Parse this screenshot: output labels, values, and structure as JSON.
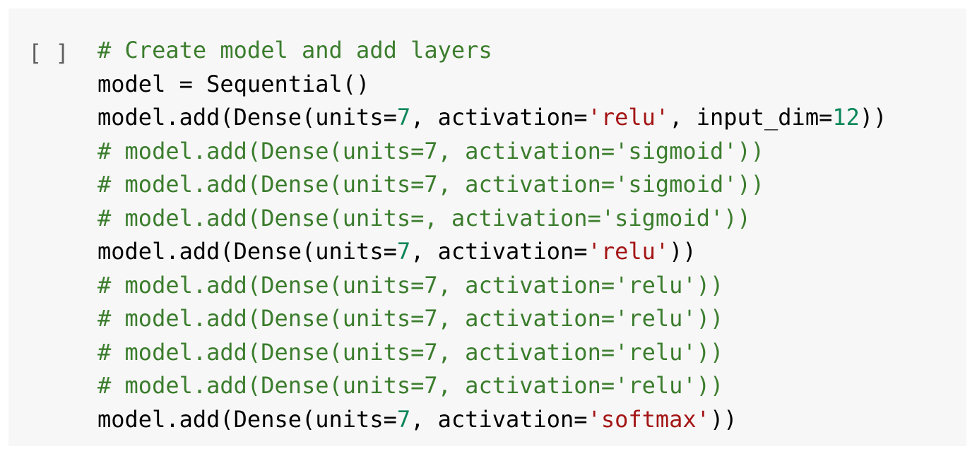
{
  "cell": {
    "run_indicator": "[ ]",
    "lines": [
      [
        {
          "t": "comment",
          "v": "# Create model and add layers"
        }
      ],
      [
        {
          "t": "default",
          "v": "model = Sequential()"
        }
      ],
      [
        {
          "t": "default",
          "v": "model.add(Dense(units="
        },
        {
          "t": "number",
          "v": "7"
        },
        {
          "t": "default",
          "v": ", activation="
        },
        {
          "t": "string",
          "v": "'relu'"
        },
        {
          "t": "default",
          "v": ", input_dim="
        },
        {
          "t": "number",
          "v": "12"
        },
        {
          "t": "default",
          "v": "))"
        }
      ],
      [
        {
          "t": "comment",
          "v": "# model.add(Dense(units=7, activation='sigmoid'))"
        }
      ],
      [
        {
          "t": "comment",
          "v": "# model.add(Dense(units=7, activation='sigmoid'))"
        }
      ],
      [
        {
          "t": "comment",
          "v": "# model.add(Dense(units=, activation='sigmoid'))"
        }
      ],
      [
        {
          "t": "default",
          "v": "model.add(Dense(units="
        },
        {
          "t": "number",
          "v": "7"
        },
        {
          "t": "default",
          "v": ", activation="
        },
        {
          "t": "string",
          "v": "'relu'"
        },
        {
          "t": "default",
          "v": "))"
        }
      ],
      [
        {
          "t": "comment",
          "v": "# model.add(Dense(units=7, activation='relu'))"
        }
      ],
      [
        {
          "t": "comment",
          "v": "# model.add(Dense(units=7, activation='relu'))"
        }
      ],
      [
        {
          "t": "comment",
          "v": "# model.add(Dense(units=7, activation='relu'))"
        }
      ],
      [
        {
          "t": "comment",
          "v": "# model.add(Dense(units=7, activation='relu'))"
        }
      ],
      [
        {
          "t": "default",
          "v": "model.add(Dense(units="
        },
        {
          "t": "number",
          "v": "7"
        },
        {
          "t": "default",
          "v": ", activation="
        },
        {
          "t": "string",
          "v": "'softmax'"
        },
        {
          "t": "default",
          "v": "))"
        }
      ]
    ]
  },
  "colors": {
    "cell_background": "#f7f7f7",
    "comment": "#3b7d2d",
    "string": "#a41515",
    "number": "#098658",
    "default": "#000000"
  }
}
